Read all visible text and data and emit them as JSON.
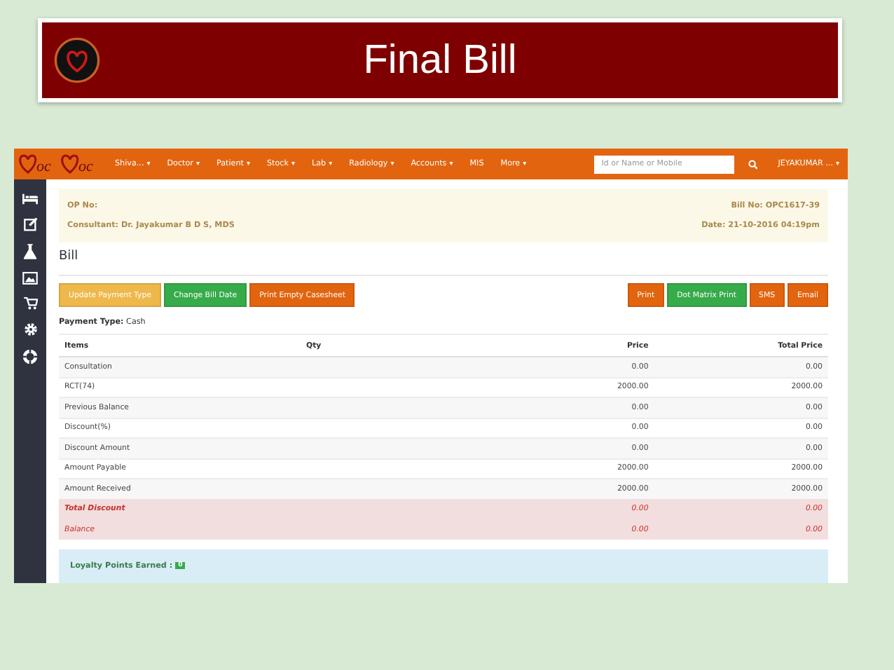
{
  "slide_title": "Final Bill",
  "logo": [
    "oc",
    "oc"
  ],
  "nav": {
    "items": [
      {
        "label": "Shiva...",
        "caret": "▾"
      },
      {
        "label": "Doctor",
        "caret": "▾"
      },
      {
        "label": "Patient",
        "caret": "▾"
      },
      {
        "label": "Stock",
        "caret": "▾"
      },
      {
        "label": "Lab",
        "caret": "▾"
      },
      {
        "label": "Radiology",
        "caret": "▾"
      },
      {
        "label": "Accounts",
        "caret": "▾"
      },
      {
        "label": "MIS"
      },
      {
        "label": "More",
        "caret": "▾"
      }
    ],
    "search": {
      "placeholder": "Id or Name or Mobile"
    },
    "user": "JEYAKUMAR ...",
    "user_caret": "▾"
  },
  "sidebar": {
    "icons": [
      {
        "kind": "bed"
      },
      {
        "kind": "edit"
      },
      {
        "kind": "flask"
      },
      {
        "kind": "image"
      },
      {
        "kind": "cart"
      },
      {
        "kind": "gear"
      },
      {
        "kind": "lifebuoy"
      }
    ]
  },
  "info": {
    "op_no": "OP No:",
    "consultant": "Consultant: Dr. Jayakumar B D S, MDS",
    "bill_no": "Bill No: OPC1617-39",
    "date": "Date: 21-10-2016 04:19pm"
  },
  "heading": "Bill",
  "left_buttons": [
    {
      "label": "Update Payment Type",
      "kind": "warning"
    },
    {
      "label": "Change Bill Date",
      "kind": "success"
    },
    {
      "label": "Print Empty Casesheet",
      "kind": "primary"
    }
  ],
  "right_buttons": [
    {
      "label": "Print",
      "kind": "primary"
    },
    {
      "label": "Dot Matrix Print",
      "kind": "success"
    },
    {
      "label": "SMS",
      "kind": "primary"
    },
    {
      "label": "Email",
      "kind": "primary"
    }
  ],
  "payment_type": "**Payment Type:** Cash",
  "table": {
    "columns": [
      "Items",
      "Qty",
      "Price",
      "Total Price"
    ],
    "rows": [
      {
        "item": "Consultation",
        "price": "0.00",
        "total": "0.00",
        "kind": "normal"
      },
      {
        "item": "RCT(74)",
        "price": "2000.00",
        "total": "2000.00",
        "kind": "normal"
      },
      {
        "item": "Previous Balance",
        "price": "0.00",
        "total": "0.00",
        "kind": "normal"
      },
      {
        "item": "Discount(%)",
        "price": "0.00",
        "total": "0.00",
        "kind": "normal"
      },
      {
        "item": "Discount Amount",
        "price": "0.00",
        "total": "0.00",
        "kind": "normal"
      },
      {
        "item": "Amount Payable",
        "price": "2000.00",
        "total": "2000.00",
        "kind": "normal"
      },
      {
        "item": "Amount Received",
        "price": "2000.00",
        "total": "2000.00",
        "kind": "normal"
      },
      {
        "item": "Total Discount",
        "price": "0.00",
        "total": "0.00",
        "kind": "danger-bold"
      },
      {
        "item": "Balance",
        "price": "0.00",
        "total": "0.00",
        "kind": "danger"
      }
    ]
  },
  "loyalty": {
    "label": "Loyalty Points Earned :",
    "badge": "0"
  }
}
